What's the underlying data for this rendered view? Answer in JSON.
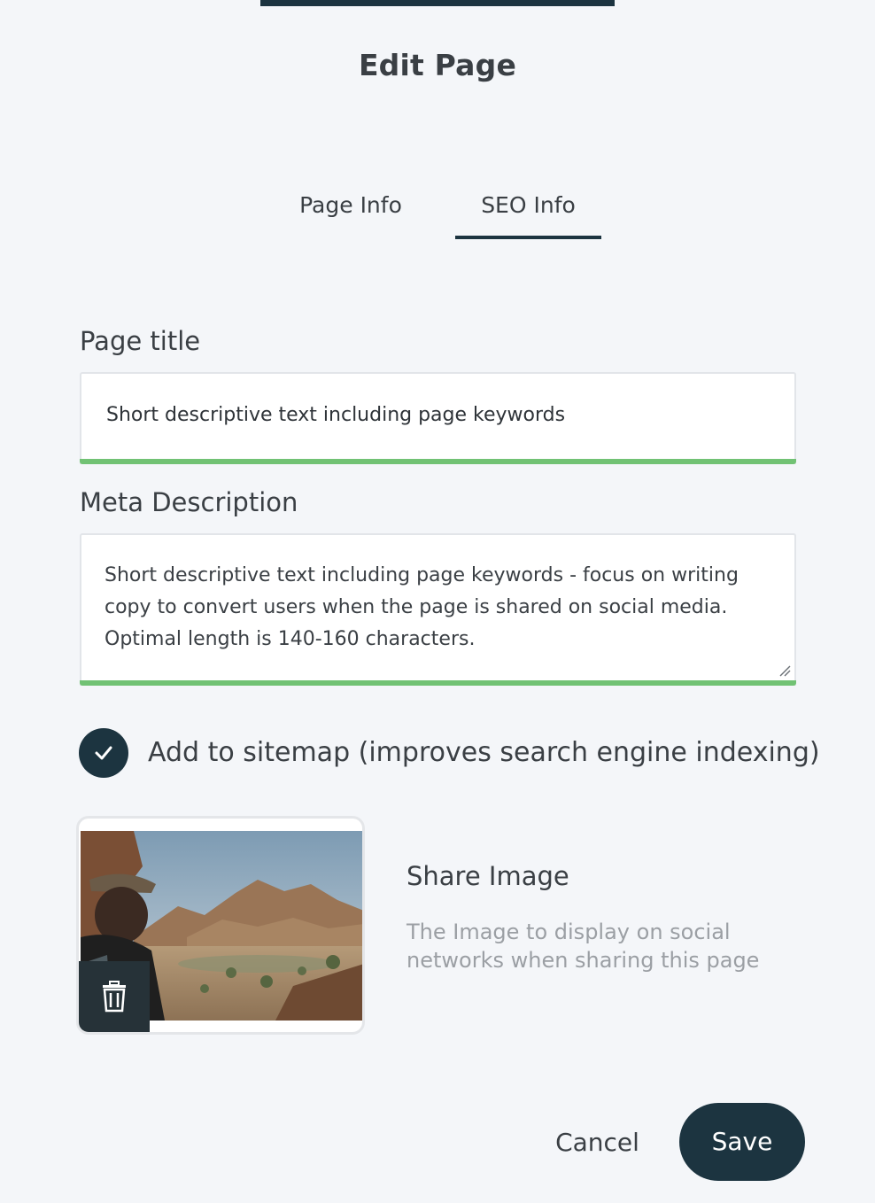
{
  "modal": {
    "title": "Edit Page"
  },
  "tabs": [
    {
      "label": "Page Info",
      "active": false
    },
    {
      "label": "SEO Info",
      "active": true
    }
  ],
  "fields": {
    "page_title": {
      "label": "Page title",
      "value": "Short descriptive text including page keywords"
    },
    "meta_description": {
      "label": "Meta Description",
      "value": "Short descriptive text including page keywords - focus on writing copy to convert users when the page is shared on social media. Optimal length is 140-160 characters."
    }
  },
  "sitemap": {
    "label": "Add to sitemap (improves search engine indexing)",
    "checked": true
  },
  "share_image": {
    "title": "Share Image",
    "description": "The Image to display on social networks when sharing this page"
  },
  "actions": {
    "cancel_label": "Cancel",
    "save_label": "Save"
  },
  "colors": {
    "primary": "#1c3440",
    "valid_green": "#71c274",
    "background": "#f4f6f9",
    "muted_text": "#9b9fa4"
  }
}
